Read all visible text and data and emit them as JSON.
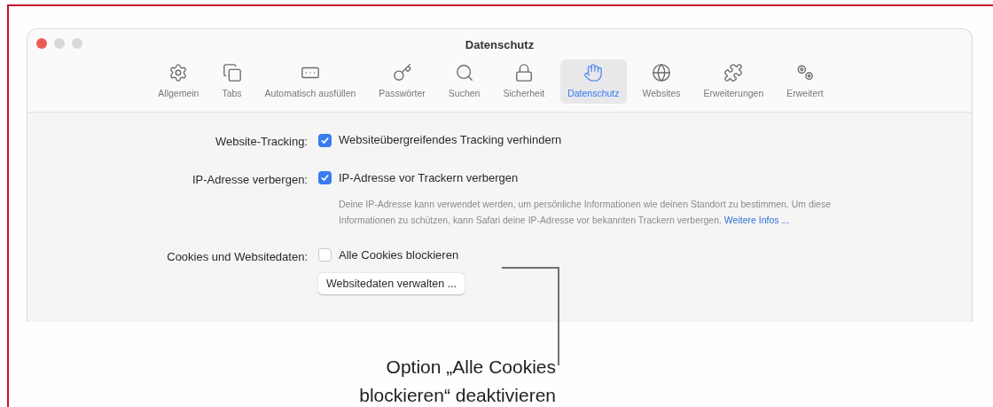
{
  "window": {
    "title": "Datenschutz"
  },
  "toolbar": {
    "items": [
      {
        "label": "Allgemein",
        "selected": false
      },
      {
        "label": "Tabs",
        "selected": false
      },
      {
        "label": "Automatisch ausfüllen",
        "selected": false
      },
      {
        "label": "Passwörter",
        "selected": false
      },
      {
        "label": "Suchen",
        "selected": false
      },
      {
        "label": "Sicherheit",
        "selected": false
      },
      {
        "label": "Datenschutz",
        "selected": true
      },
      {
        "label": "Websites",
        "selected": false
      },
      {
        "label": "Erweiterungen",
        "selected": false
      },
      {
        "label": "Erweitert",
        "selected": false
      }
    ]
  },
  "settings": [
    {
      "label": "Website-Tracking:",
      "option": {
        "label": "Websiteübergreifendes Tracking verhindern",
        "checked": true
      }
    },
    {
      "label": "IP-Adresse verbergen:",
      "option": {
        "label": "IP-Adresse vor Trackern verbergen",
        "checked": true
      },
      "description": "Deine IP-Adresse kann verwendet werden, um persönliche Informationen wie deinen Standort zu bestimmen. Um diese Informationen zu schützen, kann Safari deine IP-Adresse vor bekannten Trackern verbergen.",
      "link": "Weitere Infos ..."
    },
    {
      "label": "Cookies und Websitedaten:",
      "option": {
        "label": "Alle Cookies blockieren",
        "checked": false
      },
      "button": "Websitedaten verwalten ..."
    }
  ],
  "callout": {
    "lines": [
      "Option „Alle Cookies",
      "blockieren“ deaktivieren"
    ]
  }
}
